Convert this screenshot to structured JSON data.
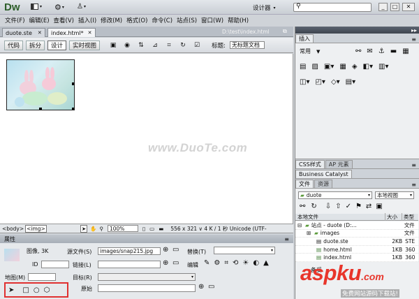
{
  "app": {
    "logo": "Dw",
    "workspace": "设计器",
    "search_placeholder": ""
  },
  "menu": [
    "文件(F)",
    "编辑(E)",
    "查看(V)",
    "插入(I)",
    "修改(M)",
    "格式(O)",
    "命令(C)",
    "站点(S)",
    "窗口(W)",
    "帮助(H)"
  ],
  "doc_tabs": [
    {
      "label": "duote.ste"
    },
    {
      "label": "index.html*"
    }
  ],
  "doc_path": "D:\\test\\index.html",
  "view_buttons": [
    "代码",
    "拆分",
    "设计",
    "实时视图"
  ],
  "title_label": "标题:",
  "title_value": "无标题文档",
  "watermark": "www.DuoTe.com",
  "status_bar": {
    "tag1": "<body>",
    "tag2": "<img>",
    "zoom": "100%",
    "info": "556 x 321 ∨ 4 K / 1 秒 Unicode (UTF-"
  },
  "insert_panel": {
    "tab": "插入",
    "category": "常用"
  },
  "css_panel": {
    "tabs": [
      "CSS样式",
      "AP 元素"
    ]
  },
  "bc_panel": {
    "tab": "Business Catalyst"
  },
  "files_panel": {
    "tabs": [
      "文件",
      "资源"
    ],
    "site": "duote",
    "view": "本地视图",
    "col_local": "本地文件",
    "col_size": "大小",
    "col_type": "类型",
    "rows": [
      {
        "name": "站点 - duote (D:...",
        "size": "",
        "type": "文件",
        "indent": 0
      },
      {
        "name": "images",
        "size": "",
        "type": "文件",
        "indent": 1
      },
      {
        "name": "duote.ste",
        "size": "2KB",
        "type": "STE",
        "indent": 1
      },
      {
        "name": "home.html",
        "size": "1KB",
        "type": "360",
        "indent": 1
      },
      {
        "name": "index.html",
        "size": "1KB",
        "type": "360",
        "indent": 1
      }
    ],
    "bottom_label": "备妥"
  },
  "properties": {
    "header": "属性",
    "image_label": "图像, 3K",
    "id_label": "ID",
    "src_label": "源文件(S)",
    "src_value": "images/snap215.jpg",
    "link_label": "链接(L)",
    "alt_label": "替换(T)",
    "edit_label": "编辑",
    "map_label": "地图(M)",
    "target_label": "目标(R)",
    "original_label": "原始"
  },
  "badge": {
    "text": "aspku",
    "sub": ".com",
    "tagline": "免费网站源码下载站!"
  }
}
